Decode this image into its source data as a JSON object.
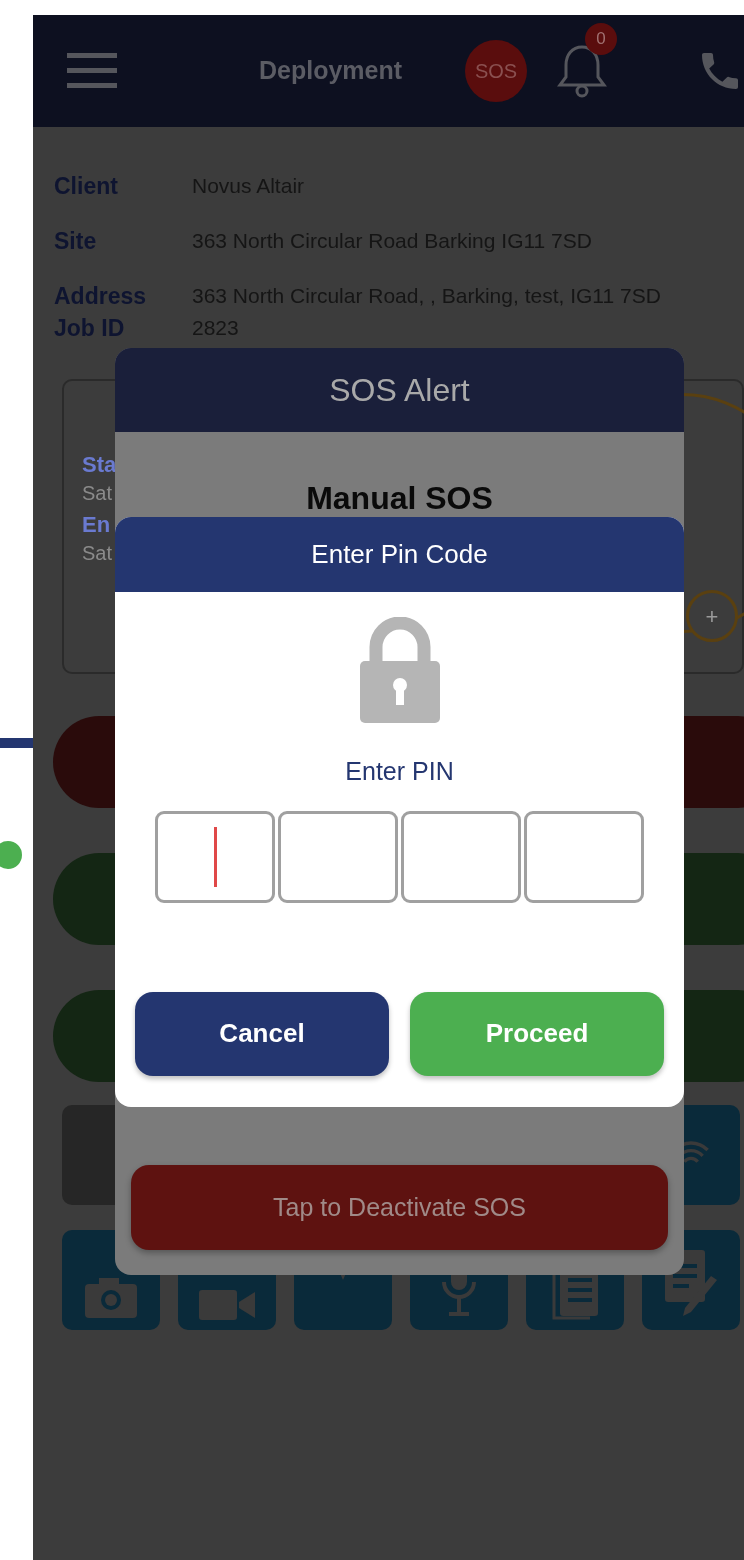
{
  "app_bar": {
    "title": "Deployment",
    "sos_badge": "SOS",
    "notification_count": "0"
  },
  "details": [
    {
      "label": "Client",
      "value": "Novus Altair"
    },
    {
      "label": "Site",
      "value": "363 North Circular Road Barking IG11 7SD"
    },
    {
      "label": "Address",
      "value": "363 North Circular Road, , Barking, test, IG11 7SD"
    },
    {
      "label": "Job ID",
      "value": "2823"
    }
  ],
  "schedule_card": {
    "rows": [
      {
        "label": "Sta",
        "value": "Sat"
      },
      {
        "label": "En",
        "value": "Sat"
      }
    ],
    "add_symbol": "+"
  },
  "sos_alert": {
    "title": "SOS Alert",
    "subtitle": "Manual SOS",
    "deactivate_button": "Tap to Deactivate SOS"
  },
  "pin_dialog": {
    "title": "Enter Pin Code",
    "prompt": "Enter PIN",
    "pin_boxes": [
      {
        "focused": true
      },
      {
        "focused": false
      },
      {
        "focused": false
      },
      {
        "focused": false
      }
    ],
    "buttons": [
      {
        "kind": "cancel",
        "label": "Cancel"
      },
      {
        "kind": "proceed",
        "label": "Proceed"
      }
    ]
  }
}
